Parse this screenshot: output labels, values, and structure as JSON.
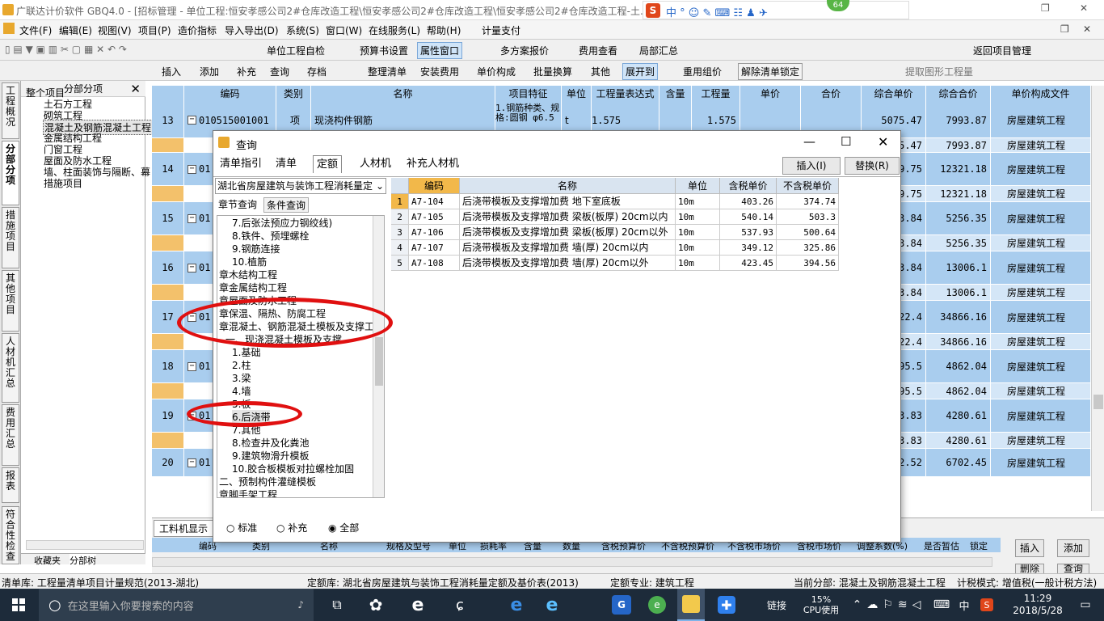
{
  "title": "广联达计价软件 GBQ4.0 - [招标管理 - 单位工程:恒安孝感公司2#仓库改造工程\\恒安孝感公司2#仓库改造工程\\恒安孝感公司2#仓库改造工程-土...  ...NRHM\\Desktop\\恒安孝感公...",
  "badge": "64",
  "menu": [
    "文件(F)",
    "编辑(E)",
    "视图(V)",
    "项目(P)",
    "造价指标",
    "导入导出(D)",
    "系统(S)",
    "窗口(W)",
    "在线服务(L)",
    "帮助(H)",
    "计量支付"
  ],
  "toolbar1": [
    "单位工程自检",
    "预算书设置",
    "属性窗口",
    "多方案报价",
    "费用查看",
    "局部汇总",
    "返回项目管理"
  ],
  "toolbar2": [
    "插入",
    "添加",
    "补充",
    "查询",
    "存档",
    "整理清单",
    "安装费用",
    "单价构成",
    "批量换算",
    "其他",
    "展开到",
    "重用组价",
    "解除清单锁定",
    "提取图形工程量"
  ],
  "vtabs": [
    "工程概况",
    "分部分项",
    "措施项目",
    "其他项目",
    "人材机汇总",
    "费用汇总",
    "报表",
    "符合性检查"
  ],
  "tree": {
    "header": "分部分项",
    "close": "✕",
    "root": "整个项目",
    "items": [
      "土石方工程",
      "砌筑工程",
      "混凝土及钢筋混凝土工程",
      "金属结构工程",
      "门窗工程",
      "屋面及防水工程",
      "墙、柱面装饰与隔断、幕",
      "措施项目"
    ],
    "bottom_tabs": [
      "收藏夹",
      "分部树"
    ]
  },
  "grid": {
    "headers": [
      "编码",
      "类别",
      "名称",
      "项目特征",
      "单位",
      "工程量表达式",
      "含量",
      "工程量",
      "单价",
      "合价",
      "综合单价",
      "综合合价",
      "单价构成文件"
    ],
    "first_row": {
      "num": "13",
      "code": "010515001001",
      "type": "项",
      "name": "现浇构件钢筋",
      "feature": "1.钢筋种类、规格:圆钢 φ6.5",
      "unit": "t",
      "expr": "1.575",
      "qty": "1.575",
      "price": "5075.47",
      "total": "7993.87",
      "file": "房屋建筑工程"
    },
    "rows": [
      {
        "num": "",
        "code": "",
        "price": "5075.47",
        "total": "7993.87",
        "file": "房屋建筑工程"
      },
      {
        "num": "14",
        "code": "01",
        "price": "759.75",
        "total": "12321.18",
        "file": "房屋建筑工程"
      },
      {
        "num": "",
        "code": "",
        "price": "759.75",
        "total": "12321.18",
        "file": "房屋建筑工程"
      },
      {
        "num": "15",
        "code": "01",
        "price": "743.84",
        "total": "5256.35",
        "file": "房屋建筑工程"
      },
      {
        "num": "",
        "code": "",
        "price": "743.84",
        "total": "5256.35",
        "file": "房屋建筑工程"
      },
      {
        "num": "16",
        "code": "01",
        "price": "743.84",
        "total": "13006.1",
        "file": "房屋建筑工程"
      },
      {
        "num": "",
        "code": "",
        "price": "743.84",
        "total": "13006.1",
        "file": "房屋建筑工程"
      },
      {
        "num": "17",
        "code": "01",
        "price": "4022.4",
        "total": "34866.16",
        "file": "房屋建筑工程"
      },
      {
        "num": "",
        "code": "",
        "price": "4022.4",
        "total": "34866.16",
        "file": "房屋建筑工程"
      },
      {
        "num": "18",
        "code": "01",
        "price": "795.5",
        "total": "4862.04",
        "file": "房屋建筑工程"
      },
      {
        "num": "",
        "code": "",
        "price": "795.5",
        "total": "4862.04",
        "file": "房屋建筑工程"
      },
      {
        "num": "19",
        "code": "01",
        "price": "333.83",
        "total": "4280.61",
        "file": "房屋建筑工程"
      },
      {
        "num": "",
        "code": "",
        "price": "333.83",
        "total": "4280.61",
        "file": "房屋建筑工程"
      },
      {
        "num": "20",
        "code": "01",
        "price": "642.52",
        "total": "6702.45",
        "file": "房屋建筑工程"
      }
    ]
  },
  "bottom": {
    "tab": "工料机显示",
    "headers": [
      "编码",
      "类别",
      "名称",
      "规格及型号",
      "单位",
      "损耗率",
      "含量",
      "数量",
      "含税预算价",
      "不含税预算价",
      "不含税市场价",
      "含税市场价",
      "调整系数(%)",
      "是否暂估",
      "锁定"
    ],
    "btn_insert": "插入",
    "btn_add": "添加",
    "btn_delete": "删除",
    "btn_query": "查询"
  },
  "dialog": {
    "title": "查询",
    "tabs": [
      "清单指引",
      "清单",
      "定额",
      "人材机",
      "补充人材机"
    ],
    "active_tab": "定额",
    "btn_insert": "插入(I)",
    "btn_replace": "替换(R)",
    "library": "湖北省房屋建筑与装饰工程消耗量定",
    "subtabs": [
      "章节查询",
      "条件查询"
    ],
    "tree": [
      "7.后张法预应力钢绞线)",
      "8.铁件、预埋螺栓",
      "9.钢筋连接",
      "10.植筋",
      "章木结构工程",
      "章金属结构工程",
      "章屋面及防水工程",
      "章保温、隔热、防腐工程",
      "章混凝土、钢筋混凝土模板及支撑工程",
      "一、现浇混凝土模板及支撑",
      "1.基础",
      "2.柱",
      "3.梁",
      "4.墙",
      "5.板",
      "6.后浇带",
      "7.其他",
      "8.检查井及化粪池",
      "9.建筑物滑升模板",
      "10.胶合板模板对拉螺栓加固",
      "二、预制构件灌缝模板",
      "章脚手架工程"
    ],
    "radios": [
      "标准",
      "补充",
      "全部"
    ],
    "table_headers": [
      "编码",
      "名称",
      "单位",
      "含税单价",
      "不含税单价"
    ],
    "rows": [
      {
        "n": "1",
        "code": "A7-104",
        "name": "后浇带模板及支撑增加费 地下室底板",
        "unit": "10m",
        "tax": "403.26",
        "notax": "374.74"
      },
      {
        "n": "2",
        "code": "A7-105",
        "name": "后浇带模板及支撑增加费 梁板(板厚) 20cm以内",
        "unit": "10m",
        "tax": "540.14",
        "notax": "503.3"
      },
      {
        "n": "3",
        "code": "A7-106",
        "name": "后浇带模板及支撑增加费 梁板(板厚) 20cm以外",
        "unit": "10m",
        "tax": "537.93",
        "notax": "500.64"
      },
      {
        "n": "4",
        "code": "A7-107",
        "name": "后浇带模板及支撑增加费 墙(厚) 20cm以内",
        "unit": "10m",
        "tax": "349.12",
        "notax": "325.86"
      },
      {
        "n": "5",
        "code": "A7-108",
        "name": "后浇带模板及支撑增加费 墙(厚) 20cm以外",
        "unit": "10m",
        "tax": "423.45",
        "notax": "394.56"
      }
    ]
  },
  "status": {
    "list_lib": "清单库: 工程量清单项目计量规范(2013-湖北)",
    "quota_lib": "定额库: 湖北省房屋建筑与装饰工程消耗量定额及基价表(2013)",
    "quota_major": "定额专业: 建筑工程",
    "current": "当前分部: 混凝土及钢筋混凝土工程",
    "tax_mode": "计税模式: 增值税(一般计税方法)"
  },
  "taskbar": {
    "search_placeholder": "在这里输入你要搜索的内容",
    "link": "链接",
    "cpu_percent": "15%",
    "cpu_label": "CPU使用",
    "ime": "中",
    "time": "11:29",
    "date": "2018/5/28"
  },
  "annotation_color": "#e01010"
}
